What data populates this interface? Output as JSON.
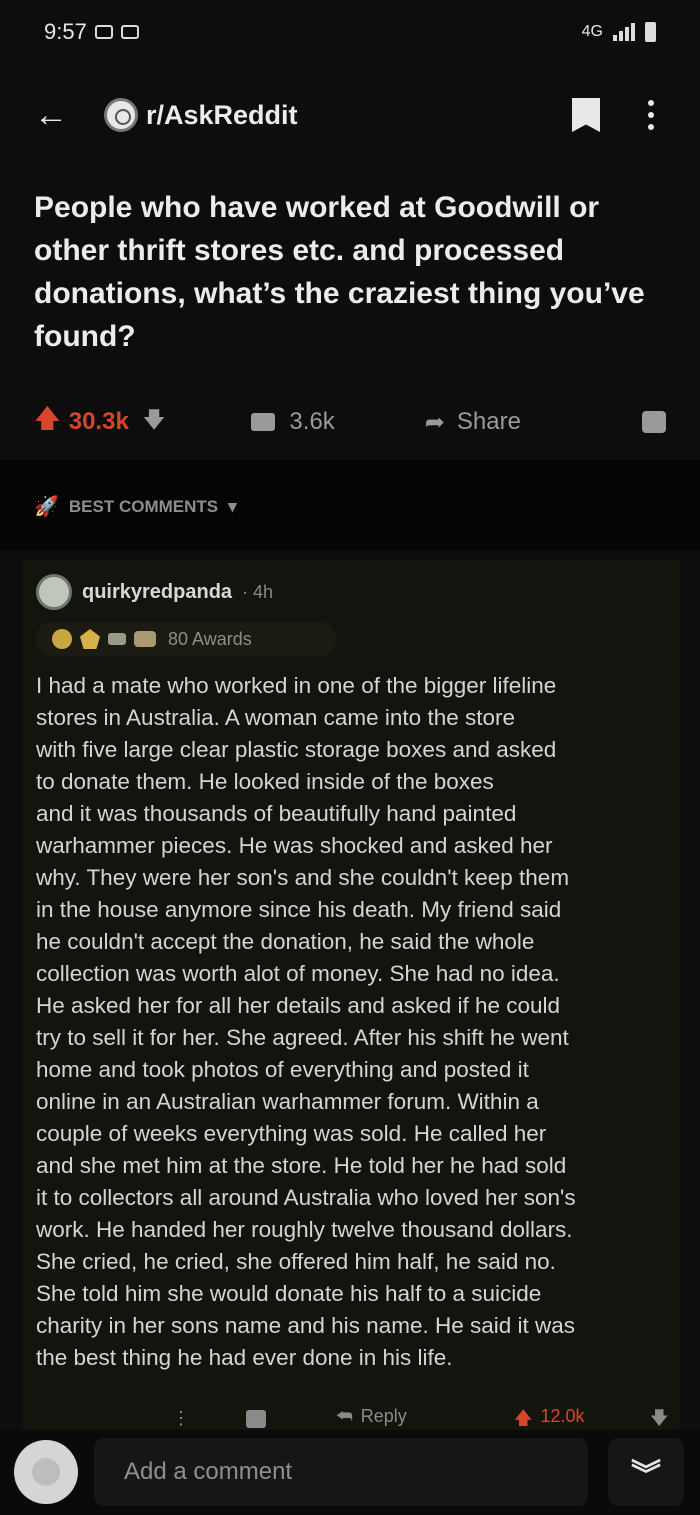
{
  "status_bar": {
    "time": "9:57",
    "network_label": "4G"
  },
  "header": {
    "subreddit": "r/AskReddit",
    "icons": [
      "back-arrow-icon",
      "subreddit-avatar-icon",
      "bookmark-icon",
      "more-vert-icon"
    ]
  },
  "post": {
    "title": "People who have worked at Goodwill or other thrift stores etc. and processed donations, what’s the craziest thing you’ve found?",
    "upvotes": "30.3k",
    "comments": "3.6k",
    "share_label": "Share"
  },
  "sort": {
    "label": "BEST COMMENTS"
  },
  "comment": {
    "username": "quirkyredpanda",
    "time": "· 4h",
    "awards_label": "80 Awards",
    "body": "I had a mate who worked in one of the bigger lifeline\nstores in Australia. A woman came into the store\nwith five large clear plastic storage boxes and asked\nto donate them. He looked inside of the boxes\nand it was thousands of beautifully hand painted\nwarhammer pieces. He was shocked and asked her\nwhy. They were her son's and she couldn't keep them\nin the house anymore since his death. My friend said\nhe couldn't accept the donation, he said the whole\ncollection was worth alot of money. She had no idea.\nHe asked her for all her details and asked if he could\ntry to sell it for her. She agreed. After his shift he went\nhome and took photos of everything and posted it\nonline in an Australian warhammer forum. Within a\ncouple of weeks everything was sold. He called her\nand she met him at the store. He told her he had sold\nit to collectors all around Australia who loved her son's\nwork. He handed her roughly twelve thousand dollars.\nShe cried, he cried, she offered him half,  he said no.\nShe told him she would donate his half to a suicide\ncharity in her sons name and his name. He said it was\nthe best thing he had ever done in his life.",
    "reply_label": "Reply",
    "score": "12.0k"
  },
  "composer": {
    "placeholder": "Add a comment"
  },
  "colors": {
    "background": "#0d0d0d",
    "upvote": "#d9452b",
    "text": "#d7d7d7"
  }
}
